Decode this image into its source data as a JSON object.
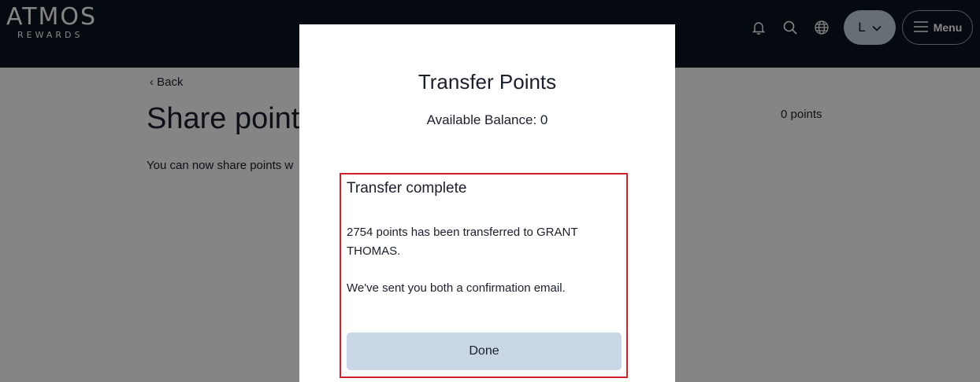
{
  "header": {
    "logo_main": "ATMOS",
    "logo_sub": "REWARDS",
    "avatar_initial": "L",
    "menu_label": "Menu",
    "icons": [
      "bell-icon",
      "search-icon",
      "globe-icon",
      "chevron-down-icon",
      "hamburger-icon"
    ]
  },
  "page": {
    "back_label": "Back",
    "title": "Share points",
    "points_total": "0 points",
    "description": "You can now share points w"
  },
  "modal": {
    "title": "Transfer Points",
    "balance": "Available Balance: 0",
    "result_heading": "Transfer complete",
    "result_message": "2754 points has been transferred to GRANT THOMAS.",
    "result_note": "We've sent you both a confirmation email.",
    "done_label": "Done"
  },
  "colors": {
    "header_bg": "#0b1422",
    "highlight_border": "#d0202a",
    "button_bg": "#c8d6e5"
  }
}
